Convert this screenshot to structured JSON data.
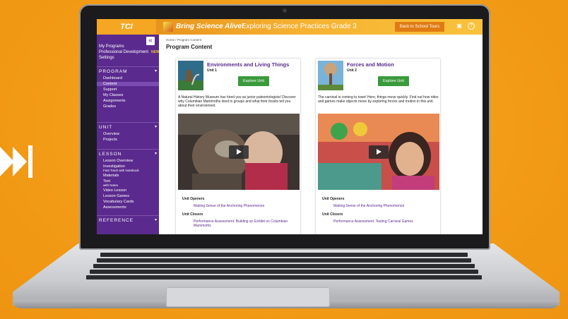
{
  "colors": {
    "accent": "#f5a623",
    "sidebar": "#5a2a8e",
    "button_green": "#3a9a3c",
    "link": "#5a2a8e"
  },
  "header": {
    "logo": "TCI",
    "brand": "Bring Science Alive!",
    "course": "Exploring Science Practices Grade 3",
    "tour_button": "Back to School Tours",
    "icons": [
      "presentation-icon",
      "help-icon"
    ]
  },
  "sidebar": {
    "collapse_icon": "«",
    "links": [
      {
        "label": "My Programs"
      },
      {
        "label": "Professional Development",
        "badge": "NEW"
      },
      {
        "label": "Settings"
      }
    ],
    "program": {
      "title": "PROGRAM",
      "items": [
        "Dashboard",
        "Content",
        "Support",
        "My Classes",
        "Assignments",
        "Grades"
      ],
      "active": "Content"
    },
    "unit": {
      "title": "UNIT",
      "items": [
        "Overview",
        "Projects"
      ]
    },
    "lesson": {
      "title": "LESSON",
      "items": [
        {
          "label": "Lesson Overview"
        },
        {
          "label": "Investigation",
          "sub": "Fast Track with Notebook"
        },
        {
          "label": "Materials"
        },
        {
          "label": "Text",
          "sub": "with Notes"
        },
        {
          "label": "Video Lesson"
        },
        {
          "label": "Lesson Games"
        },
        {
          "label": "Vocabulary Cards"
        },
        {
          "label": "Assessments"
        }
      ]
    },
    "reference": {
      "title": "REFERENCE"
    }
  },
  "main": {
    "breadcrumb": "Home / Program Content",
    "title": "Program Content",
    "units": [
      {
        "title": "Environments and Living Things",
        "unit": "Unit 1",
        "explore": "Explore Unit",
        "description": "A Natural History Museum has hired you as junior paleontologists! Discover why Columbian Mammoths lived in groups and what their fossils tell you about their environment.",
        "openers_label": "Unit Openers",
        "opener": "Making Sense of the Anchoring Phenomenon",
        "closers_label": "Unit Closers",
        "closer": "Performance Assessment: Building an Exhibit on Columbian Mammoths"
      },
      {
        "title": "Forces and Motion",
        "unit": "Unit 2",
        "explore": "Explore Unit",
        "description": "The carnival is coming to town! Here, things move quickly. Find out how rides and games make objects move by exploring forces and motion in this unit.",
        "openers_label": "Unit Openers",
        "opener": "Making Sense of the Anchoring Phenomenon",
        "closers_label": "Unit Closers",
        "closer": "Performance Assessment: Testing Carnival Games"
      }
    ]
  }
}
